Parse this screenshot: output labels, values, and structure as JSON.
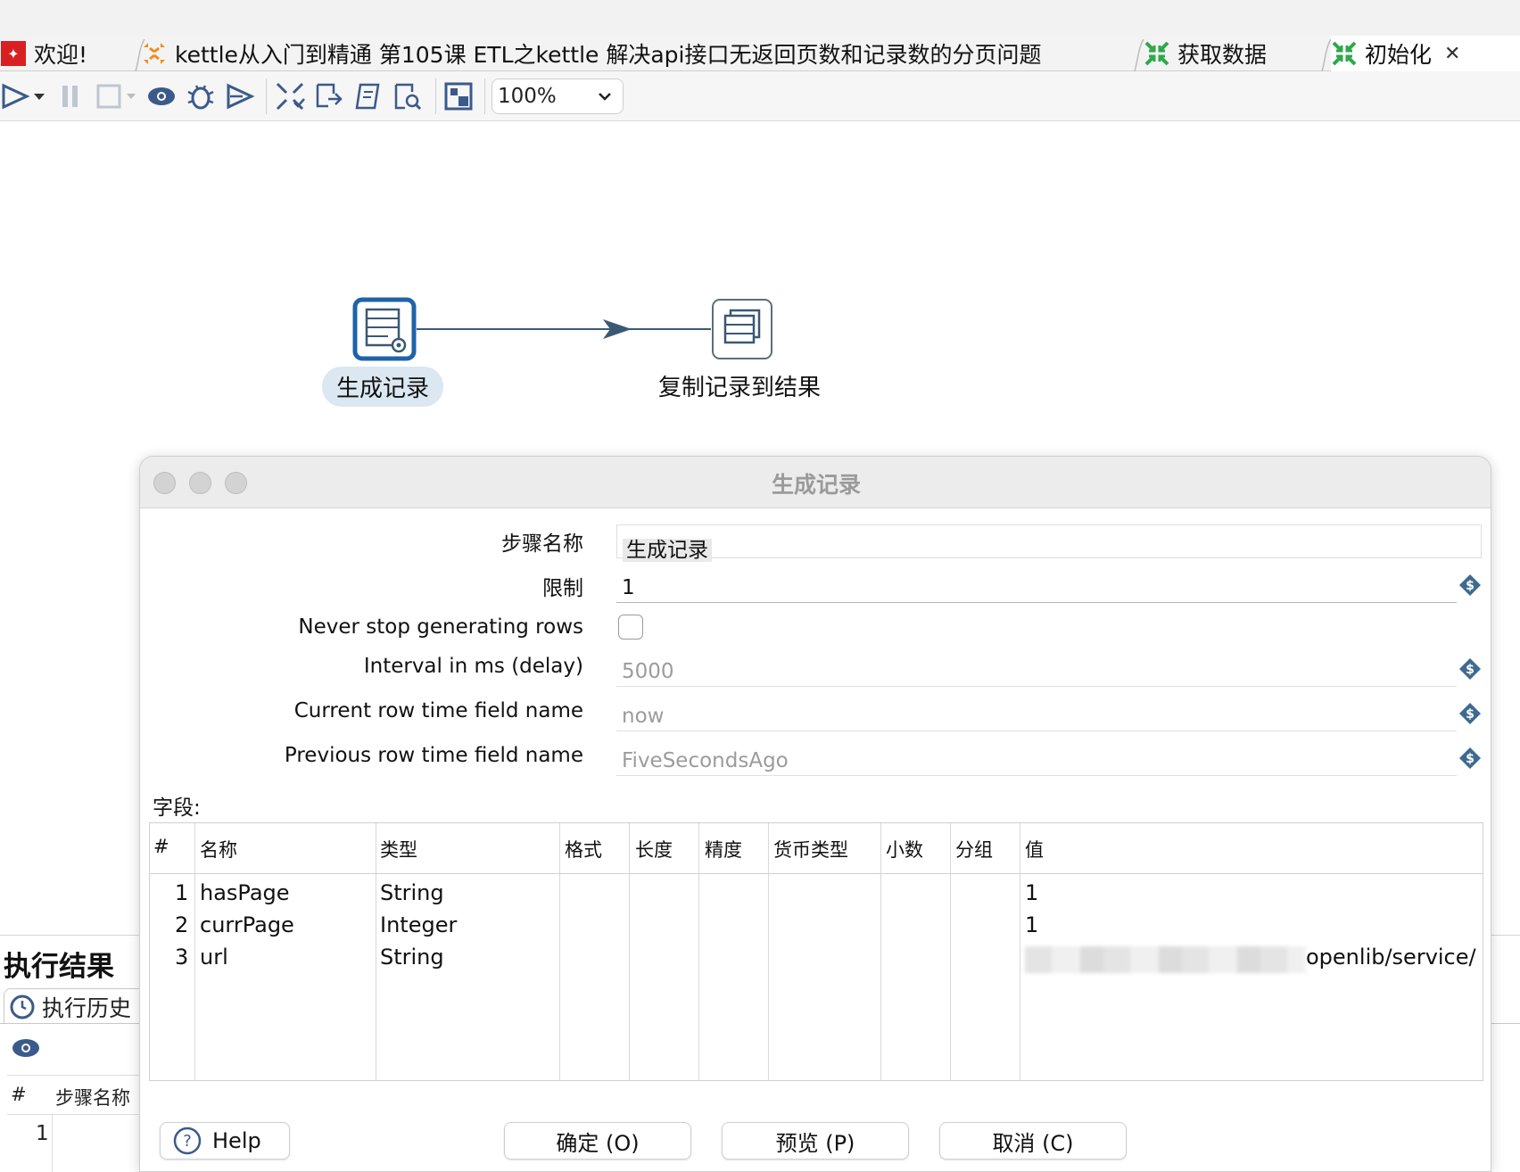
{
  "tabs": [
    {
      "label": "欢迎!",
      "icon": "welcome-icon"
    },
    {
      "label": "kettle从入门到精通 第105课 ETL之kettle 解决api接口无返回页数和记录数的分页问题",
      "icon": "job-icon"
    },
    {
      "label": "获取数据",
      "icon": "transformation-icon"
    },
    {
      "label": "初始化",
      "icon": "transformation-icon",
      "active": true,
      "close": "✕"
    }
  ],
  "toolbar": {
    "zoom": "100%",
    "icons": [
      "run-icon",
      "run-dropdown-icon",
      "pause-icon",
      "stop-icon",
      "preview-icon",
      "debug-icon",
      "replay-icon",
      "verify-icon",
      "impact-icon",
      "sql-icon",
      "explore-db-icon",
      "show-results-icon"
    ]
  },
  "canvas": {
    "steps": [
      {
        "label": "生成记录",
        "icon": "generate-rows-icon",
        "selected": true
      },
      {
        "label": "复制记录到结果",
        "icon": "copy-rows-to-result-icon",
        "selected": false
      }
    ]
  },
  "results_panel": {
    "title": "执行结果",
    "tab": "执行历史",
    "header_hash": "#",
    "header_step": "步骤名称",
    "row1": "1"
  },
  "dialog": {
    "title": "生成记录",
    "step_name_label": "步骤名称",
    "step_name_value": "生成记录",
    "limit_label": "限制",
    "limit_value": "1",
    "never_stop_label": "Never stop generating rows",
    "never_stop_checked": false,
    "interval_label": "Interval in ms (delay)",
    "interval_value": "5000",
    "current_time_label": "Current row time field name",
    "current_time_value": "now",
    "previous_time_label": "Previous row time field name",
    "previous_time_value": "FiveSecondsAgo",
    "fields_label": "字段:",
    "grid": {
      "headers": [
        "#",
        "名称",
        "类型",
        "格式",
        "长度",
        "精度",
        "货币类型",
        "小数",
        "分组",
        "值"
      ],
      "rows": [
        {
          "num": "1",
          "name": "hasPage",
          "type": "String",
          "value": "1"
        },
        {
          "num": "2",
          "name": "currPage",
          "type": "Integer",
          "value": "1"
        },
        {
          "num": "3",
          "name": "url",
          "type": "String",
          "value": "openlib/service/"
        }
      ]
    },
    "buttons": {
      "help": "Help",
      "ok": "确定 (O)",
      "preview": "预览 (P)",
      "cancel": "取消 (C)"
    }
  },
  "colors": {
    "accent": "#1f63a8",
    "hop": "#3b5873",
    "selected_label_bg": "#dbe7f1",
    "var_icon": "#3f6a8f",
    "transformation_icon": "#2ea84a"
  }
}
